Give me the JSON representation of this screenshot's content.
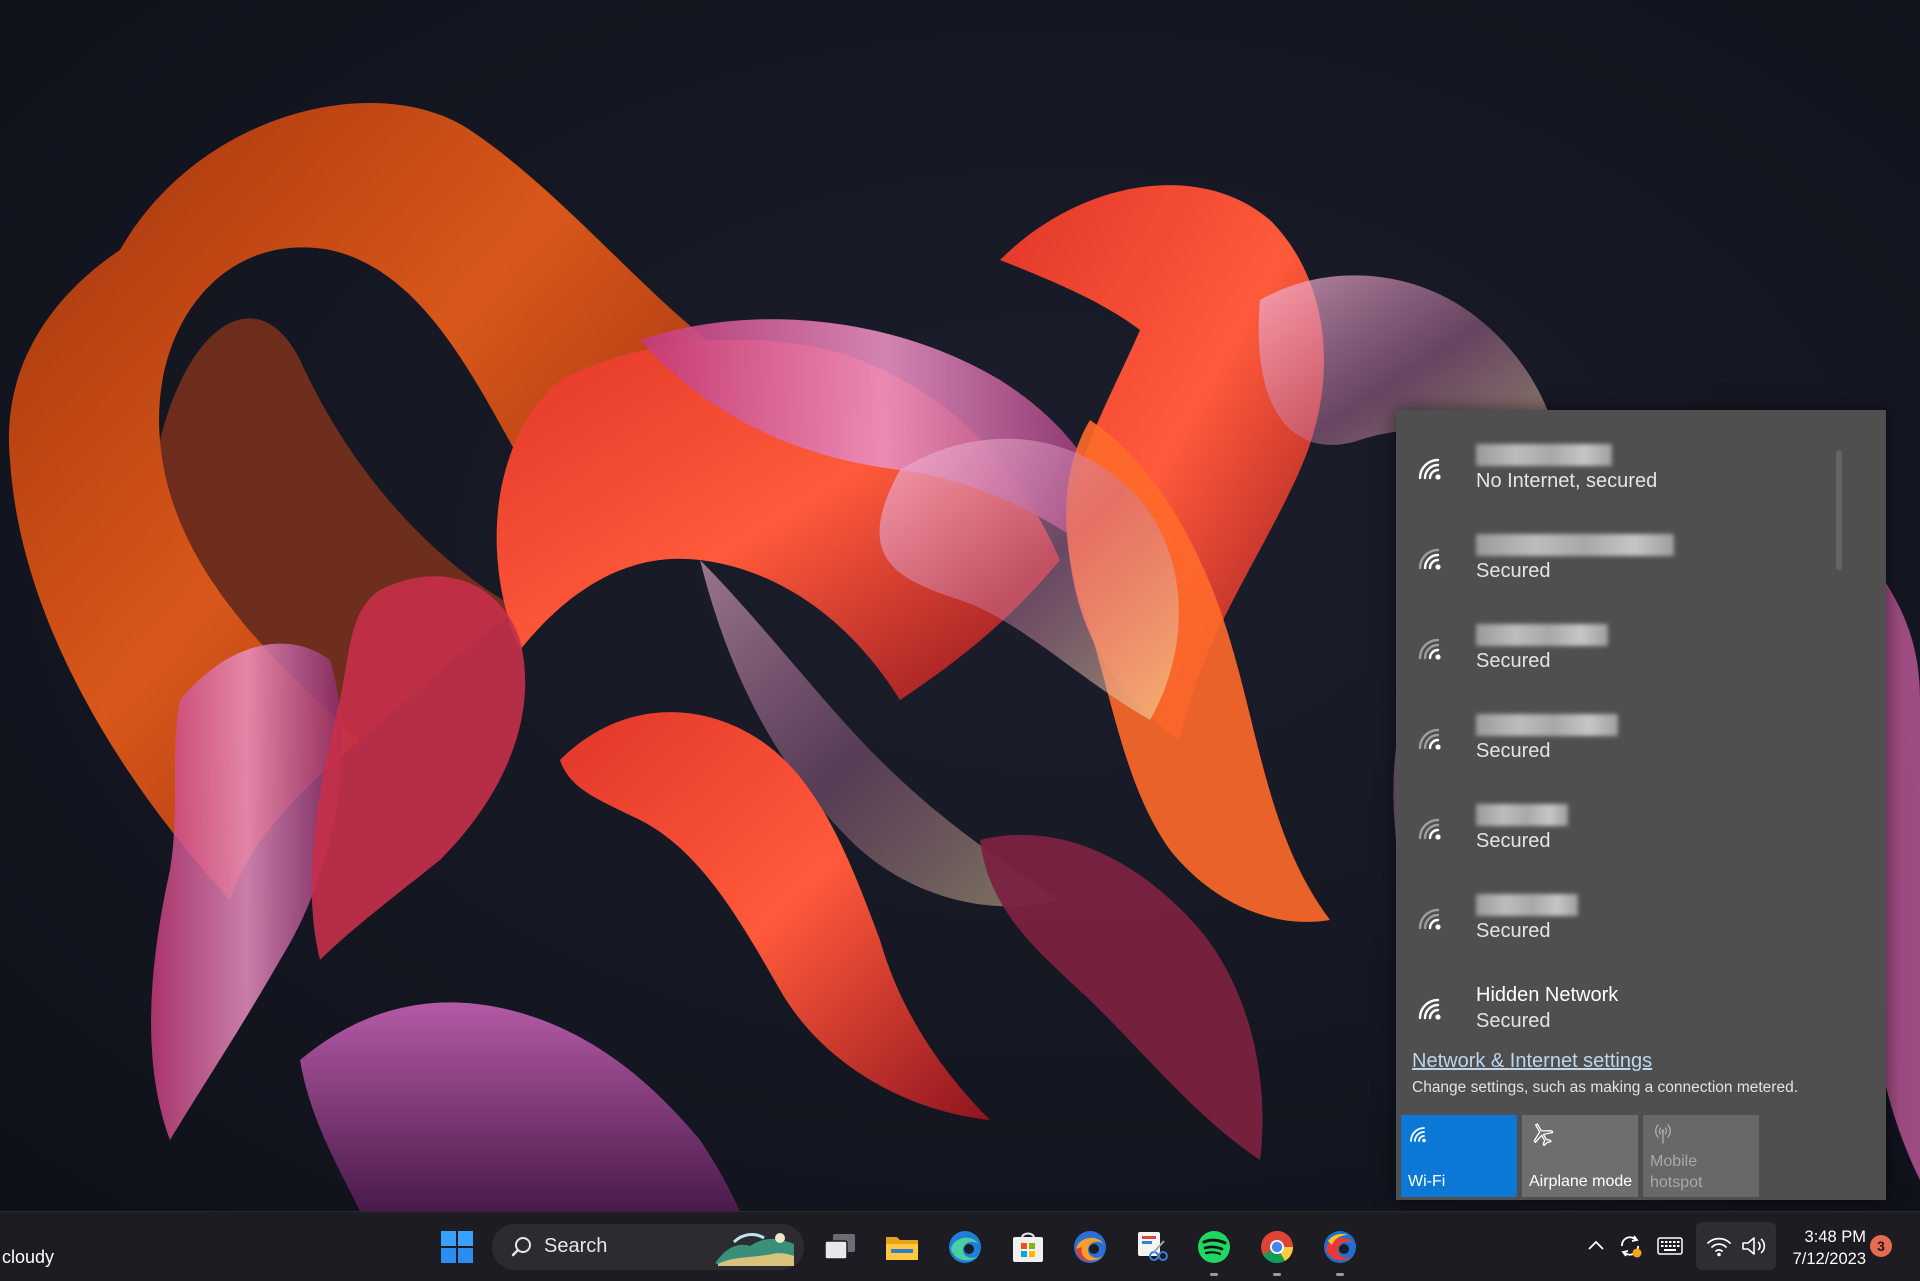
{
  "network_flyout": {
    "networks": [
      {
        "name": "",
        "status": "No Internet, secured",
        "signal": "wifi-signal-icon"
      },
      {
        "name": "",
        "status": "Secured",
        "signal": "wifi-signal-icon"
      },
      {
        "name": "",
        "status": "Secured",
        "signal": "wifi-signal-icon"
      },
      {
        "name": "",
        "status": "Secured",
        "signal": "wifi-signal-icon"
      },
      {
        "name": "",
        "status": "Secured",
        "signal": "wifi-signal-icon"
      },
      {
        "name": "",
        "status": "Secured",
        "signal": "wifi-signal-icon"
      },
      {
        "name": "Hidden Network",
        "status": "Secured",
        "signal": "wifi-signal-icon"
      }
    ],
    "settings_link": "Network & Internet settings",
    "settings_description": "Change settings, such as making a connection metered.",
    "quick_actions": {
      "wifi": {
        "label": "Wi-Fi",
        "active": true,
        "color": "#0a78d4"
      },
      "airplane": {
        "label": "Airplane mode",
        "active": false
      },
      "hotspot": {
        "line1": "Mobile",
        "line2": "hotspot",
        "enabled": false
      }
    }
  },
  "taskbar": {
    "weather": "cloudy",
    "search_label": "Search",
    "pinned_apps": [
      "start-icon",
      "task-view-icon",
      "file-explorer-icon",
      "edge-icon",
      "microsoft-store-icon",
      "edge-beta-icon",
      "snipping-tool-icon",
      "spotify-icon",
      "chrome-icon",
      "edge-dev-icon"
    ],
    "tray": {
      "time": "3:48 PM",
      "date": "7/12/2023",
      "notification_count": "3"
    }
  }
}
